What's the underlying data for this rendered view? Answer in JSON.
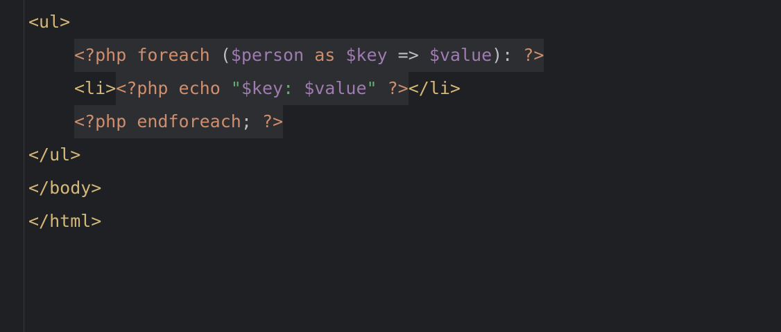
{
  "code_lines": [
    {
      "parts": [
        {
          "text": "<ul>",
          "kind": "tag"
        }
      ]
    },
    {
      "parts": [
        {
          "text": "<?php",
          "kind": "php"
        },
        {
          "text": " foreach ",
          "kind": "php"
        },
        {
          "text": "(",
          "kind": "plain"
        },
        {
          "text": "$person",
          "kind": "var"
        },
        {
          "text": " as ",
          "kind": "php"
        },
        {
          "text": "$key",
          "kind": "var"
        },
        {
          "text": " => ",
          "kind": "plain"
        },
        {
          "text": "$value",
          "kind": "var"
        },
        {
          "text": "): ",
          "kind": "plain"
        },
        {
          "text": "?>",
          "kind": "php"
        }
      ]
    },
    {
      "parts": [
        {
          "text": "<li>",
          "kind": "tag"
        },
        {
          "text": "<?php",
          "kind": "php"
        },
        {
          "text": " echo ",
          "kind": "php"
        },
        {
          "text": "\"",
          "kind": "str"
        },
        {
          "text": "$key",
          "kind": "var"
        },
        {
          "text": ": ",
          "kind": "str"
        },
        {
          "text": "$value",
          "kind": "var"
        },
        {
          "text": "\"",
          "kind": "str"
        },
        {
          "text": " ?>",
          "kind": "php"
        },
        {
          "text": "</li>",
          "kind": "tag"
        }
      ]
    },
    {
      "parts": [
        {
          "text": "<?php",
          "kind": "php"
        },
        {
          "text": " endforeach",
          "kind": "php"
        },
        {
          "text": "; ",
          "kind": "plain"
        },
        {
          "text": "?>",
          "kind": "php"
        }
      ]
    },
    {
      "parts": [
        {
          "text": "</ul>",
          "kind": "tag"
        }
      ]
    },
    {
      "parts": [
        {
          "text": "</body>",
          "kind": "tag"
        }
      ]
    },
    {
      "parts": [
        {
          "text": "</html>",
          "kind": "tag"
        }
      ]
    }
  ],
  "colors": {
    "background": "#1f2023",
    "tag": "#d5b778",
    "php": "#cf8e6d",
    "variable": "#9e7bb0",
    "string": "#6aab73",
    "plain": "#bcbec4",
    "php_block_bg": "#2d2e31"
  }
}
